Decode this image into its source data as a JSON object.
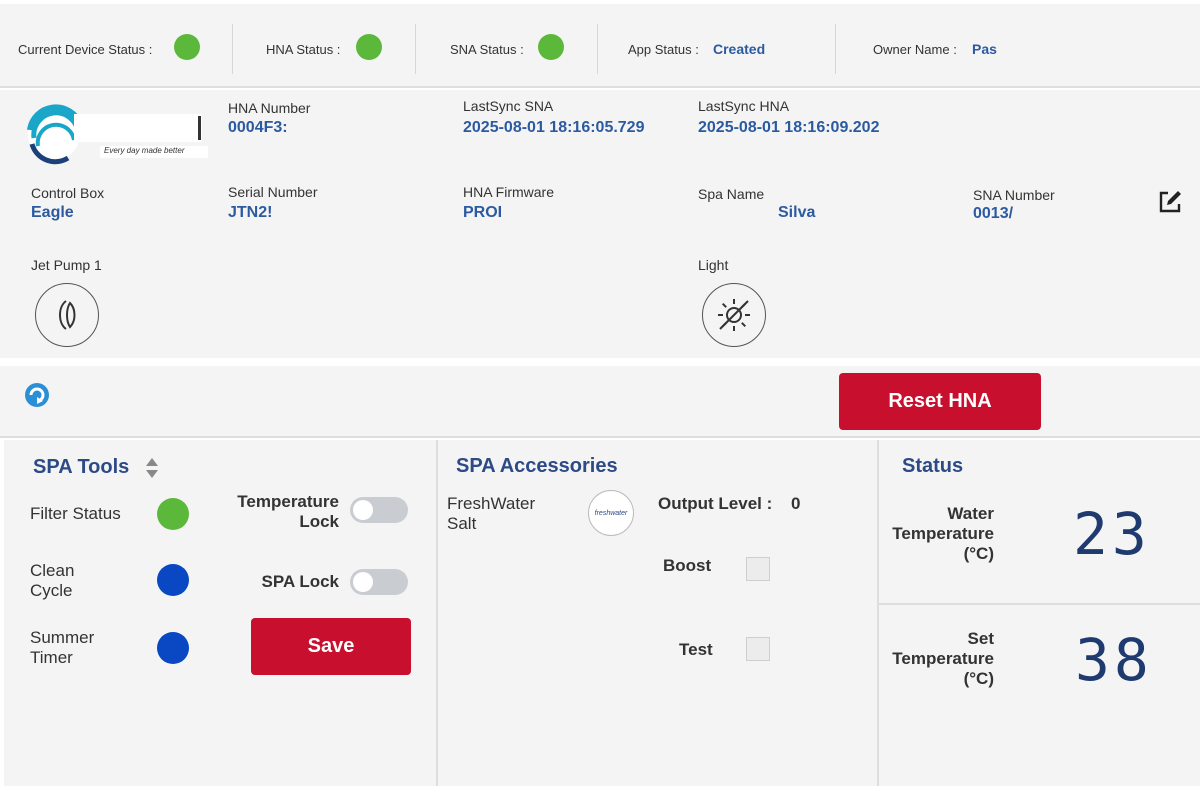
{
  "status_bar": {
    "current_device_label": "Current Device Status :",
    "hna_label": "HNA Status :",
    "sna_label": "SNA Status :",
    "app_label": "App Status :",
    "app_value": "Created",
    "owner_label": "Owner Name :",
    "owner_value": "Pas",
    "status_color_ok": "#5cb83b"
  },
  "info": {
    "logo_tagline": "Every day made better",
    "hna_number_label": "HNA Number",
    "hna_number_value": "0004F3:",
    "last_sync_sna_label": "LastSync SNA",
    "last_sync_sna_value": "2025-08-01 18:16:05.729",
    "last_sync_hna_label": "LastSync HNA",
    "last_sync_hna_value": "2025-08-01 18:16:09.202",
    "control_box_label": "Control Box",
    "control_box_value": "Eagle",
    "serial_number_label": "Serial Number",
    "serial_number_value": "JTN2!",
    "hna_firmware_label": "HNA Firmware",
    "hna_firmware_value": "PROI",
    "spa_name_label": "Spa Name",
    "spa_name_value": "Silva",
    "sna_number_label": "SNA Number",
    "sna_number_value": "0013/",
    "jet_pump_label": "Jet Pump 1",
    "light_label": "Light"
  },
  "actions": {
    "reset_hna_label": "Reset HNA",
    "accent_red": "#c8102e"
  },
  "spa_tools": {
    "title": "SPA Tools",
    "filter_status_label": "Filter Status",
    "filter_status_color": "#5cb83b",
    "clean_cycle_label_1": "Clean",
    "clean_cycle_label_2": "Cycle",
    "clean_cycle_color": "#0a47c2",
    "summer_timer_label_1": "Summer",
    "summer_timer_label_2": "Timer",
    "summer_timer_color": "#0a47c2",
    "temperature_lock_label_1": "Temperature",
    "temperature_lock_label_2": "Lock",
    "spa_lock_label": "SPA Lock",
    "save_label": "Save"
  },
  "spa_accessories": {
    "title": "SPA Accessories",
    "accessory_name_1": "FreshWater",
    "accessory_name_2": "Salt",
    "accessory_logo_text": "freshwater",
    "output_level_label": "Output Level :",
    "output_level_value": "0",
    "boost_label": "Boost",
    "test_label": "Test"
  },
  "status_panel": {
    "title": "Status",
    "water_temp_label_1": "Water",
    "water_temp_label_2": "Temperature",
    "water_temp_label_3": "(°C)",
    "water_temp_value": "23",
    "set_temp_label_1": "Set",
    "set_temp_label_2": "Temperature",
    "set_temp_label_3": "(°C)",
    "set_temp_value": "38",
    "digit_color": "#1f3a6e"
  }
}
